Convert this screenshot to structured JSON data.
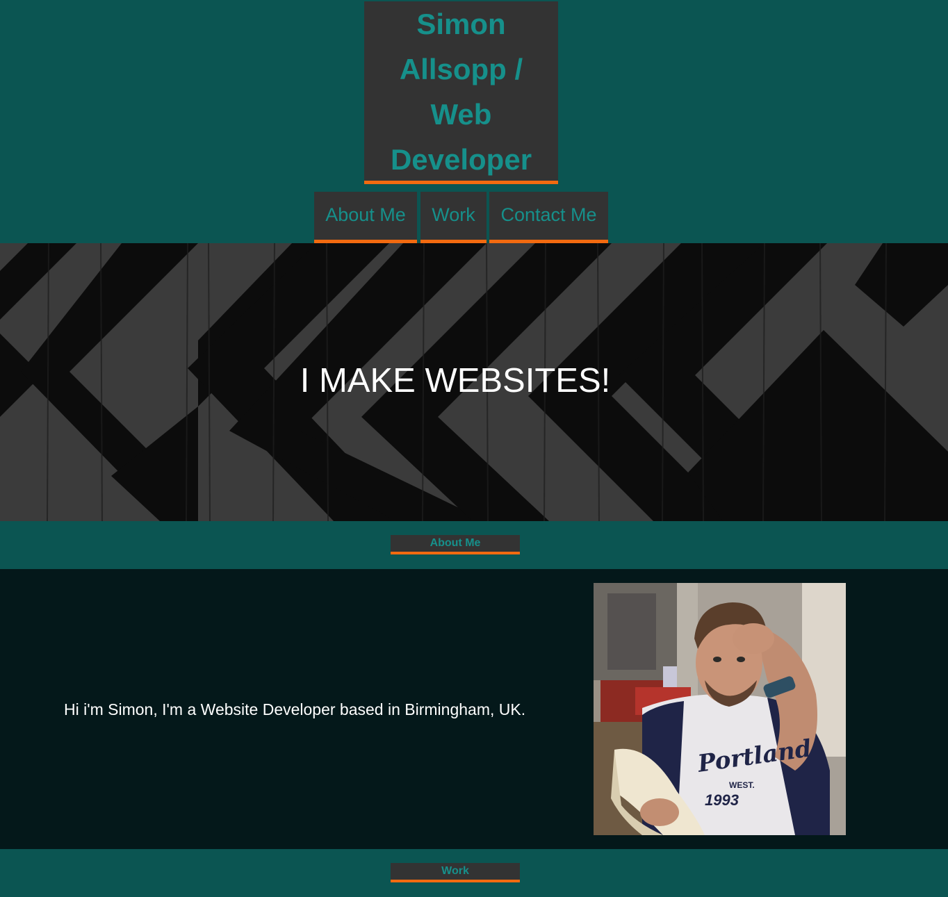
{
  "site": {
    "title": "Simon Allsopp / Web Developer",
    "title_lines": [
      "Simon",
      "Allsopp /",
      "Web",
      "Developer"
    ]
  },
  "nav": {
    "items": [
      {
        "label": "About Me"
      },
      {
        "label": "Work"
      },
      {
        "label": "Contact Me"
      }
    ]
  },
  "hero": {
    "headline": "I MAKE WEBSITES!"
  },
  "sections": {
    "about": {
      "label": "About Me",
      "text": "Hi i'm Simon, I'm a Website Developer based in Birmingham, UK."
    },
    "work": {
      "label": "Work"
    }
  },
  "photo": {
    "shirt_text": "Portland",
    "shirt_subtext": "WEST.",
    "shirt_year": "1993"
  },
  "colors": {
    "background_teal": "#0b5552",
    "panel_dark": "#333333",
    "accent_orange": "#f26a10",
    "text_teal": "#16908b",
    "about_bg": "#04181a"
  }
}
